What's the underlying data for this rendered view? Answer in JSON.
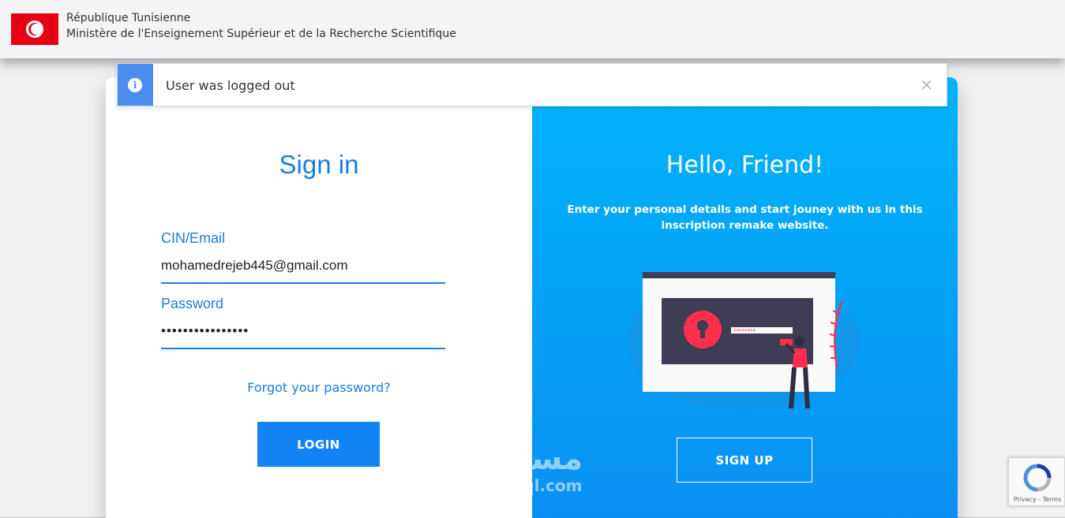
{
  "header": {
    "country": "République Tunisienne",
    "ministry": "Ministère de l'Enseignement Supérieur et de la Recherche Scientifique"
  },
  "alert": {
    "message": "User was logged out",
    "close_glyph": "×",
    "info_glyph": "i"
  },
  "signin": {
    "title": "Sign in",
    "cin_label": "CIN/Email",
    "cin_value": "mohamedrejeb445@gmail.com",
    "password_label": "Password",
    "password_value": "••••••••••••••••",
    "forgot_link": "Forgot your password?",
    "login_button": "LOGIN"
  },
  "panel": {
    "title": "Hello, Friend!",
    "subtitle": "Enter your personal details and start jouney with us in this inscription remake website.",
    "signup_button": "SIGN UP"
  },
  "watermark": {
    "arabic": "مستقل",
    "latin": "mostaql.com"
  },
  "recaptcha": {
    "terms": "Privacy - Terms"
  },
  "colors": {
    "accent": "#1a7ee0",
    "panel_top": "#00b4fb",
    "panel_bottom": "#0a8ff2",
    "alert_badge": "#4b8def",
    "flag_red": "#e70013"
  }
}
